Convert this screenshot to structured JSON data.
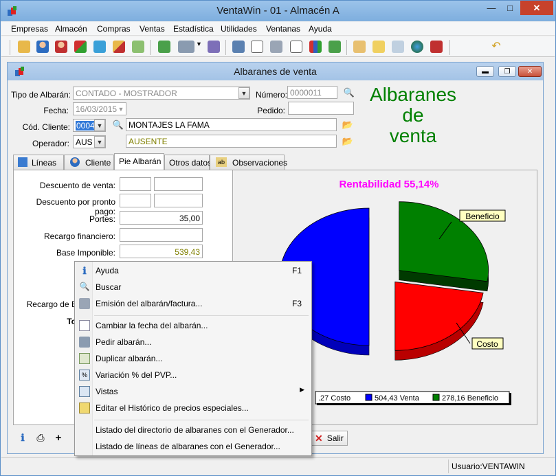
{
  "window": {
    "title": "VentaWin - 01 - Almacén A"
  },
  "menubar": [
    "Empresas",
    "Almacén",
    "Compras",
    "Ventas",
    "Estadística",
    "Utilidades",
    "Ventanas",
    "Ayuda"
  ],
  "child": {
    "title": "Albaranes de venta"
  },
  "form": {
    "tipo_label": "Tipo de Albarán:",
    "tipo_value": "CONTADO - MOSTRADOR",
    "numero_label": "Número:",
    "numero_value": "0000011",
    "fecha_label": "Fecha:",
    "fecha_value": "16/03/2015",
    "pedido_label": "Pedido:",
    "pedido_value": "",
    "cliente_label": "Cód. Cliente:",
    "cliente_code": "0004",
    "cliente_name": "MONTAJES LA FAMA",
    "operador_label": "Operador:",
    "operador_code": "AUS",
    "operador_name": "AUSENTE",
    "big_title": [
      "Albaranes",
      "de",
      "venta"
    ]
  },
  "tabs": [
    "Líneas",
    "Cliente",
    "Pie Albarán",
    "Otros datos",
    "Observaciones"
  ],
  "pie": {
    "descuento_venta": "Descuento de venta:",
    "descuento_pronto": "Descuento por pronto pago:",
    "portes_label": "Portes:",
    "portes_value": "35,00",
    "recargo_fin": "Recargo financiero:",
    "base_label": "Base Imponible:",
    "base_value": "539,43",
    "recargo_e": "Recargo de E",
    "total_frag": "To"
  },
  "chart_data": {
    "type": "pie",
    "title": "Rentabilidad 55,14%",
    "slices": [
      {
        "label": "Costo",
        "value": 226.27,
        "color": "#ff0000"
      },
      {
        "label": "Venta",
        "value": 504.43,
        "color": "#0000ff"
      },
      {
        "label": "Beneficio",
        "value": 278.16,
        "color": "#008000"
      }
    ],
    "callouts": [
      "Beneficio",
      "Costo"
    ],
    "legend": [
      ".27 Costo",
      "504,43 Venta",
      "278,16 Beneficio"
    ]
  },
  "context_menu": {
    "items": [
      {
        "label": "Ayuda",
        "shortcut": "F1",
        "icon": "info-icon"
      },
      {
        "label": "Buscar",
        "shortcut": "",
        "icon": "search-icon"
      },
      {
        "label": "Emisión del albarán/factura...",
        "shortcut": "F3",
        "icon": "printer-icon"
      },
      {
        "label": "Cambiar la fecha del albarán...",
        "shortcut": "",
        "icon": "calendar-icon"
      },
      {
        "label": "Pedir albarán...",
        "shortcut": "",
        "icon": "truck-icon"
      },
      {
        "label": "Duplicar albarán...",
        "shortcut": "",
        "icon": "duplicate-icon"
      },
      {
        "label": "Variación % del PVP...",
        "shortcut": "",
        "icon": "percent-icon"
      },
      {
        "label": "Vistas",
        "shortcut": "",
        "icon": "views-icon"
      },
      {
        "label": "Editar el Histórico de precios especiales...",
        "shortcut": "",
        "icon": "history-icon"
      },
      {
        "label": "Listado del directorio de albaranes con el Generador...",
        "shortcut": "",
        "icon": ""
      },
      {
        "label": "Listado de líneas de albaranes con el Generador...",
        "shortcut": "",
        "icon": ""
      }
    ]
  },
  "bottom": {
    "salir_label": "Salir",
    "plus": "+"
  },
  "status": {
    "usuario": "Usuario:VENTAWIN"
  }
}
